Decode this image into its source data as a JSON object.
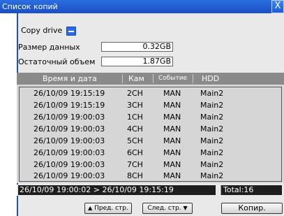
{
  "window": {
    "title": "Список копий",
    "close_glyph": "X"
  },
  "copy_drive": {
    "label": "Copy drive",
    "icon": "drive-icon"
  },
  "data_size": {
    "label": "Размер данных",
    "value": "0.32GB"
  },
  "remaining": {
    "label": "Остаточный объем",
    "value": "1.87GB"
  },
  "columns": {
    "datetime": "Время и дата",
    "cam": "Кам",
    "event": "Событие",
    "hdd": "HDD"
  },
  "rows": [
    {
      "datetime": "26/10/09 19:15:19",
      "cam": "2CH",
      "event": "MAN",
      "hdd": "Main2"
    },
    {
      "datetime": "26/10/09 19:15:19",
      "cam": "3CH",
      "event": "MAN",
      "hdd": "Main2"
    },
    {
      "datetime": "26/10/09 19:00:03",
      "cam": "1CH",
      "event": "MAN",
      "hdd": "Main2"
    },
    {
      "datetime": "26/10/09 19:00:03",
      "cam": "4CH",
      "event": "MAN",
      "hdd": "Main2"
    },
    {
      "datetime": "26/10/09 19:00:03",
      "cam": "5CH",
      "event": "MAN",
      "hdd": "Main2"
    },
    {
      "datetime": "26/10/09 19:00:03",
      "cam": "6CH",
      "event": "MAN",
      "hdd": "Main2"
    },
    {
      "datetime": "26/10/09 19:00:03",
      "cam": "7CH",
      "event": "MAN",
      "hdd": "Main2"
    },
    {
      "datetime": "26/10/09 19:00:03",
      "cam": "8CH",
      "event": "MAN",
      "hdd": "Main2"
    }
  ],
  "status": {
    "range": "26/10/09 19:00:02 > 26/10/09 19:15:19",
    "total": "Total:16"
  },
  "buttons": {
    "prev": "Пред. стр.",
    "next": "След. стр.",
    "copy": "Копир."
  },
  "colors": {
    "accent": "#1b4fc4",
    "panel": "#e9e9e9",
    "list": "#d6d6d6",
    "header": "#8a8a8a",
    "status_bg": "#1e1e1e"
  }
}
